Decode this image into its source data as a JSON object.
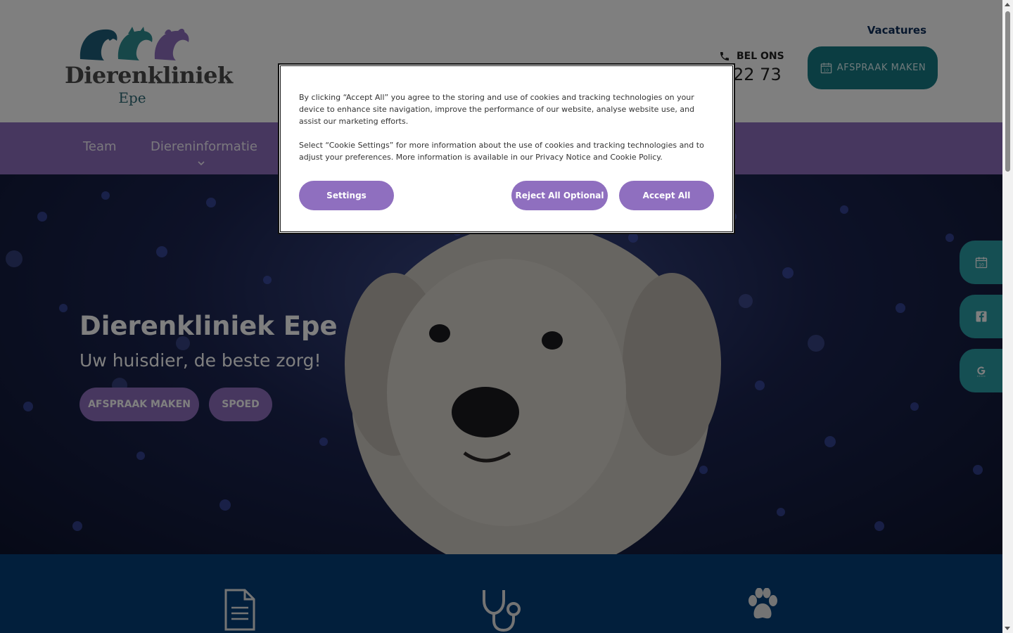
{
  "header": {
    "logo": {
      "name": "Dierenkliniek",
      "sub": "Epe",
      "animal_colors": [
        "#1f5f7a",
        "#2e8f93",
        "#8f6fbf"
      ]
    },
    "vacatures_label": "Vacatures",
    "bel_ons_label": "BEL ONS",
    "phone_visible": "22 73",
    "cta_label": "AFSPRAAK MAKEN",
    "cta_icon": "calendar-icon",
    "cta_icon_day": "10"
  },
  "nav": {
    "items": [
      {
        "label": "Team"
      },
      {
        "label": "Diereninformatie",
        "has_dropdown": true
      }
    ]
  },
  "hero": {
    "title": "Dierenkliniek Epe",
    "subtitle": "Uw huisdier, de beste zorg!",
    "buttons": [
      {
        "label": "AFSPRAAK MAKEN"
      },
      {
        "label": "SPOED"
      }
    ]
  },
  "services": {
    "icons": [
      "document-icon",
      "stethoscope-icon",
      "paw-icon"
    ]
  },
  "side_buttons": [
    {
      "icon": "calendar-icon",
      "day": "10"
    },
    {
      "icon": "facebook-icon"
    },
    {
      "icon": "google-icon"
    }
  ],
  "cookie_banner": {
    "paragraph1": "By clicking “Accept All” you agree to the storing and use of cookies and tracking technologies on your device to enhance site navigation, improve the performance of our website, analyse website use, and assist our marketing efforts.",
    "paragraph2": "Select “Cookie Settings” for more information about the use of cookies and tracking technologies and to adjust your preferences. More information is available in our Privacy Notice and Cookie Policy.",
    "settings_label": "Settings",
    "reject_label": "Reject All Optional",
    "accept_label": "Accept All"
  },
  "colors": {
    "brand_purple": "#8f6fbf",
    "brand_teal": "#167b85",
    "side_teal": "#2a9ea7",
    "navy": "#053e78",
    "overlay": "rgba(0,0,0,0.5)"
  }
}
